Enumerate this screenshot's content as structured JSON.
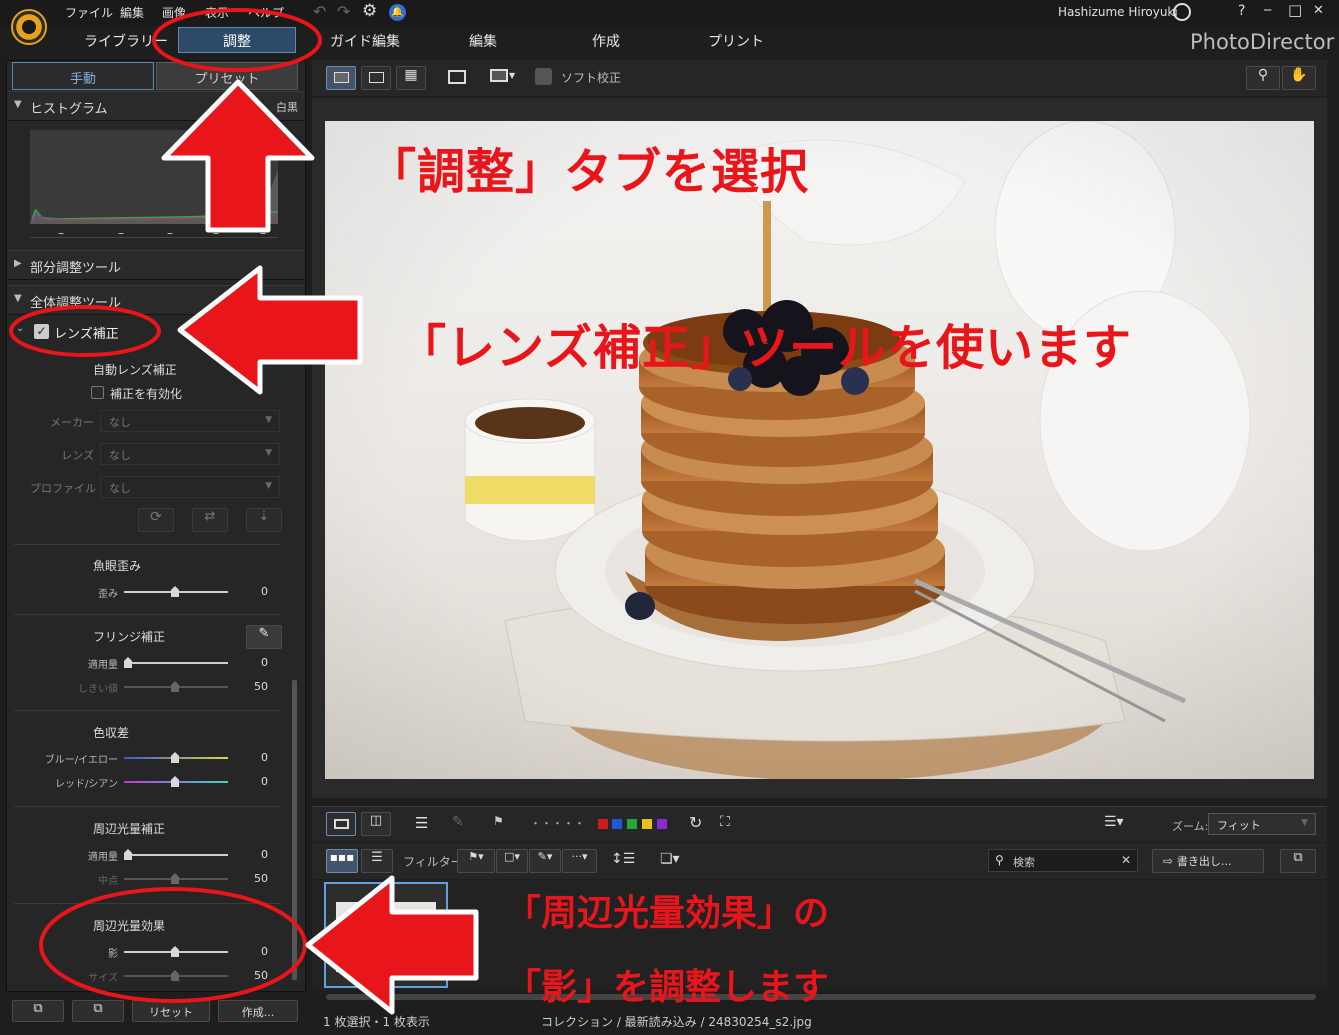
{
  "menu": {
    "file": "ファイル",
    "edit": "編集",
    "image": "画像",
    "view": "表示",
    "help": "ヘルプ"
  },
  "user": {
    "name": "Hashizume Hiroyuki"
  },
  "window": {
    "help": "?",
    "minimize": "─",
    "maximize": "□",
    "close": "✕"
  },
  "modes": {
    "library": "ライブラリー",
    "adjust": "調整",
    "guided": "ガイド編集",
    "edit": "編集",
    "create": "作成",
    "print": "プリント"
  },
  "app": {
    "brand": "PhotoDirector"
  },
  "left": {
    "tab_manual": "手動",
    "tab_preset": "プリセット",
    "histogram": {
      "title": "ヒストグラム",
      "bw": "白黒",
      "dashes": [
        "–",
        "–",
        "–",
        "–",
        "–"
      ]
    },
    "partial_tool": "部分調整ツール",
    "global_tool": "全体調整ツール",
    "lens": {
      "title": "レンズ補正",
      "auto": "自動レンズ補正",
      "enable": "補正を有効化",
      "maker_label": "メーカー",
      "maker_value": "なし",
      "lens_label": "レンズ",
      "lens_value": "なし",
      "profile_label": "プロファイル",
      "profile_value": "なし"
    },
    "fisheye": {
      "title": "魚眼歪み",
      "distortion_label": "歪み",
      "distortion_value": "0"
    },
    "fringe": {
      "title": "フリンジ補正",
      "amount_label": "適用量",
      "amount_value": "0",
      "threshold_label": "しきい値",
      "threshold_value": "50"
    },
    "ca": {
      "title": "色収差",
      "by_label": "ブルー/イエロー",
      "by_value": "0",
      "rc_label": "レッド/シアン",
      "rc_value": "0"
    },
    "vignette_corr": {
      "title": "周辺光量補正",
      "amount_label": "適用量",
      "amount_value": "0",
      "mid_label": "中点",
      "mid_value": "50"
    },
    "vignette_fx": {
      "title": "周辺光量効果",
      "shadow_label": "影",
      "shadow_value": "0",
      "size_label": "サイズ",
      "size_value": "50"
    },
    "bottom": {
      "reset": "リセット",
      "create": "作成..."
    }
  },
  "toolbar": {
    "soft_proof": "ソフト校正"
  },
  "filmstrip": {
    "zoom_label": "ズーム:",
    "zoom_value": "フィット",
    "filter_label": "フィルター:",
    "search_placeholder": "検索",
    "export": "書き出し...",
    "dots": "・・・・・",
    "colors": [
      "#d01a1a",
      "#1f58d8",
      "#22a83a",
      "#e8c21a",
      "#8a2ad0"
    ]
  },
  "status": {
    "selection": "1 枚選択・1 枚表示",
    "path": "コレクション / 最新読み込み / 24830254_s2.jpg"
  },
  "annotations": {
    "adjust_tab": "「調整」タブを選択",
    "lens_tool": "「レンズ補正」ツールを使います",
    "vignette_line1": "「周辺光量効果」の",
    "vignette_line2": "「影」を調整します"
  }
}
